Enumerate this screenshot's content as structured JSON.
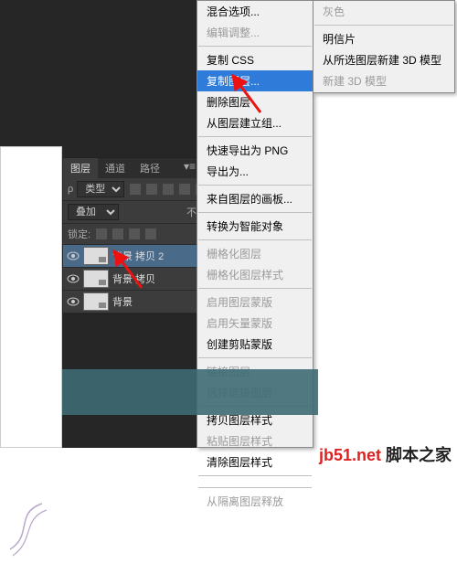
{
  "layers_panel": {
    "tabs": {
      "layers": "图层",
      "channels": "通道",
      "paths": "路径"
    },
    "kind_label": "类型",
    "blend_mode": "叠加",
    "opacity_label": "不",
    "lock_label": "锁定:",
    "items": [
      {
        "name": "背景 拷贝 2",
        "selected": true
      },
      {
        "name": "背景 拷贝",
        "selected": false
      },
      {
        "name": "背景",
        "selected": false
      }
    ]
  },
  "context_menu": {
    "col1": [
      {
        "label": "混合选项...",
        "enabled": true
      },
      {
        "label": "编辑调整...",
        "enabled": false
      },
      {
        "sep": true
      },
      {
        "label": "复制 CSS",
        "enabled": true
      },
      {
        "label": "复制图层...",
        "enabled": true,
        "highlight": true
      },
      {
        "label": "删除图层",
        "enabled": true
      },
      {
        "label": "从图层建立组...",
        "enabled": true
      },
      {
        "sep": true
      },
      {
        "label": "快速导出为 PNG",
        "enabled": true
      },
      {
        "label": "导出为...",
        "enabled": true
      },
      {
        "sep": true
      },
      {
        "label": "来自图层的画板...",
        "enabled": true
      },
      {
        "sep": true
      },
      {
        "label": "转换为智能对象",
        "enabled": true
      },
      {
        "sep": true
      },
      {
        "label": "栅格化图层",
        "enabled": false
      },
      {
        "label": "栅格化图层样式",
        "enabled": false
      },
      {
        "sep": true
      },
      {
        "label": "启用图层蒙版",
        "enabled": false
      },
      {
        "label": "启用矢量蒙版",
        "enabled": false
      },
      {
        "label": "创建剪贴蒙版",
        "enabled": true
      },
      {
        "sep": true
      },
      {
        "label": "链接图层",
        "enabled": false
      },
      {
        "label": "选择链接图层",
        "enabled": false
      },
      {
        "sep": true
      },
      {
        "label": "拷贝图层样式",
        "enabled": true
      },
      {
        "label": "粘贴图层样式",
        "enabled": false
      },
      {
        "label": "清除图层样式",
        "enabled": true
      },
      {
        "sep": true
      },
      {
        "label": "",
        "enabled": false
      },
      {
        "sep": true
      },
      {
        "label": "从隔离图层释放",
        "enabled": false
      }
    ],
    "col2": [
      {
        "label": "灰色",
        "enabled": false
      },
      {
        "sep": true
      },
      {
        "label": "明信片",
        "enabled": true
      },
      {
        "label": "从所选图层新建 3D 模型",
        "enabled": true
      },
      {
        "label": "新建 3D 模型",
        "enabled": false
      }
    ]
  },
  "watermark": {
    "site": "脚本之家",
    "domain": "jb51.net"
  }
}
